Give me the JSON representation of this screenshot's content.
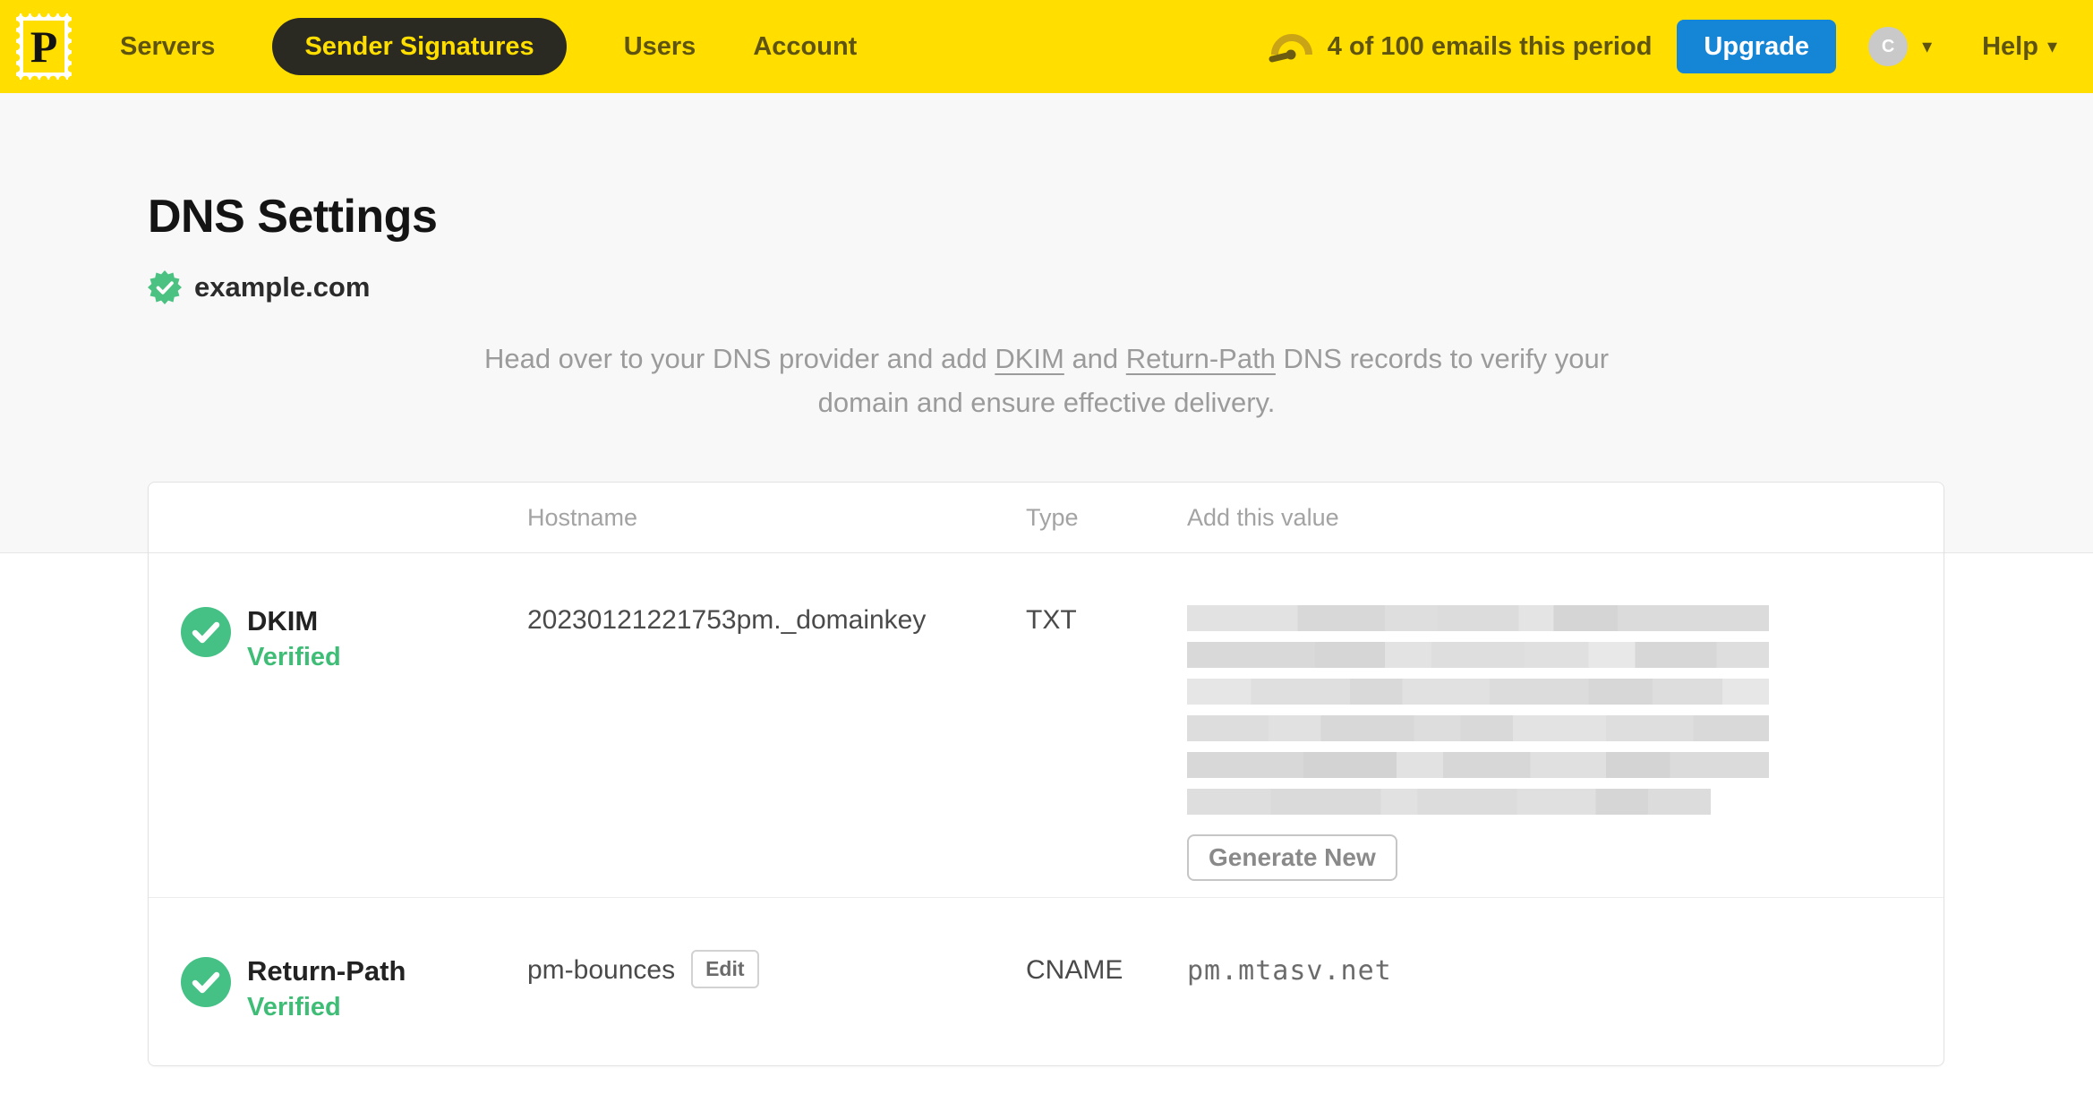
{
  "header": {
    "brand_letter": "P",
    "nav": [
      {
        "label": "Servers",
        "active": false
      },
      {
        "label": "Sender Signatures",
        "active": true
      },
      {
        "label": "Users",
        "active": false
      },
      {
        "label": "Account",
        "active": false
      }
    ],
    "usage_text": "4 of 100 emails this period",
    "upgrade_label": "Upgrade",
    "avatar_initial": "C",
    "help_label": "Help"
  },
  "page": {
    "title": "DNS Settings",
    "domain": "example.com",
    "intro": {
      "pre": "Head over to your DNS provider and add ",
      "link_dkim": "DKIM",
      "mid": " and ",
      "link_return_path": "Return-Path",
      "post": " DNS records to verify your domain and ensure effective delivery."
    }
  },
  "table": {
    "columns": {
      "hostname": "Hostname",
      "type": "Type",
      "value": "Add this value"
    },
    "rows": [
      {
        "name": "DKIM",
        "status": "Verified",
        "hostname": "20230121221753pm._domainkey",
        "type": "TXT",
        "value_redacted": true,
        "action_label": "Generate New"
      },
      {
        "name": "Return-Path",
        "status": "Verified",
        "hostname": "pm-bounces",
        "edit_label": "Edit",
        "type": "CNAME",
        "value": "pm.mtasv.net"
      }
    ]
  },
  "colors": {
    "brand_yellow": "#FFDE00",
    "nav_text": "#5E5410",
    "active_pill": "#2A2A23",
    "upgrade_blue": "#1585D6",
    "verified_green": "#3FBD77",
    "check_circle_green": "#45C186",
    "hero_background": "#F8F8F8"
  }
}
